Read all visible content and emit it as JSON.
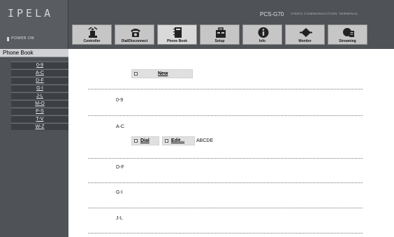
{
  "brand": {
    "logo": "IPELA",
    "model": "PCS-G70",
    "subtitle": "VIDEO COMMUNICATION TERMINAL",
    "power_status": "POWER ON"
  },
  "toolbar": [
    {
      "label": "Controller",
      "icon": "controller-icon"
    },
    {
      "label": "Dial/Disconnect",
      "icon": "telephone-icon"
    },
    {
      "label": "Phone Book",
      "icon": "phone-book-icon",
      "active": true
    },
    {
      "label": "Setup",
      "icon": "toolbox-icon"
    },
    {
      "label": "Info",
      "icon": "info-icon"
    },
    {
      "label": "Monitor",
      "icon": "monitor-icon"
    },
    {
      "label": "Streaming",
      "icon": "streaming-icon"
    }
  ],
  "nav": {
    "title": "Phone Book",
    "items": [
      "0-9",
      "A-C",
      "D-F",
      "G-I",
      "J-L",
      "M-O",
      "P-S",
      "T-V",
      "W-Z"
    ]
  },
  "content": {
    "new_button": "New",
    "sections": [
      "0-9",
      "A-C",
      "D-F",
      "G-I",
      "J-L"
    ],
    "entry": {
      "dial_label": "Dial",
      "edit_label": "Edit...",
      "name": "ABCDE"
    }
  }
}
